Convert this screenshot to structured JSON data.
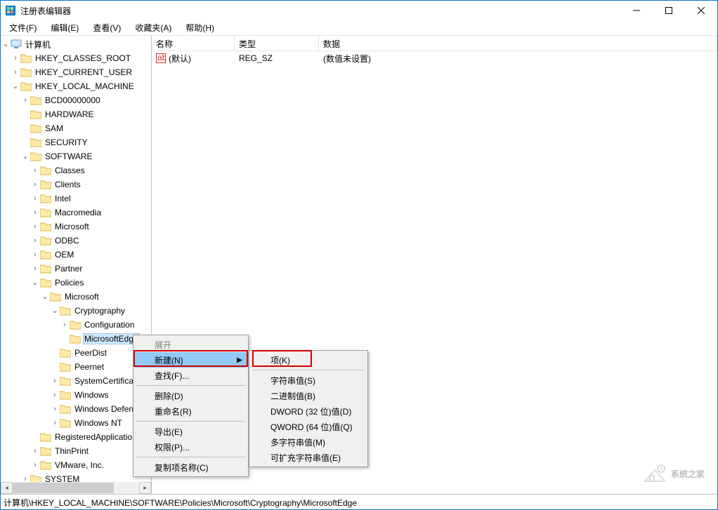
{
  "window": {
    "title": "注册表编辑器"
  },
  "menu": {
    "file": "文件(F)",
    "edit": "编辑(E)",
    "view": "查看(V)",
    "favorites": "收藏夹(A)",
    "help": "帮助(H)"
  },
  "tree": {
    "root": "计算机",
    "hkcr": "HKEY_CLASSES_ROOT",
    "hkcu": "HKEY_CURRENT_USER",
    "hklm": "HKEY_LOCAL_MACHINE",
    "bcd": "BCD00000000",
    "hardware": "HARDWARE",
    "sam": "SAM",
    "security": "SECURITY",
    "software": "SOFTWARE",
    "classes": "Classes",
    "clients": "Clients",
    "intel": "Intel",
    "macromedia": "Macromedia",
    "microsoft": "Microsoft",
    "odbc": "ODBC",
    "oem": "OEM",
    "partner": "Partner",
    "policies": "Policies",
    "policies_microsoft": "Microsoft",
    "cryptography": "Cryptography",
    "configuration": "Configuration",
    "microsoftedge": "MicrosoftEdge",
    "peerdist": "PeerDist",
    "peernet": "Peernet",
    "systemcert": "SystemCertificates",
    "windows": "Windows",
    "windowsdef": "Windows Defender",
    "windowsnt": "Windows NT",
    "regapps": "RegisteredApplications",
    "thinprint": "ThinPrint",
    "vmware": "VMware, Inc.",
    "system": "SYSTEM"
  },
  "list": {
    "headers": {
      "name": "名称",
      "type": "类型",
      "data": "数据"
    },
    "row0": {
      "name": "(默认)",
      "type": "REG_SZ",
      "data": "(数值未设置)"
    }
  },
  "ctx1": {
    "expand": "展开",
    "new": "新建(N)",
    "find": "查找(F)...",
    "delete": "删除(D)",
    "rename": "重命名(R)",
    "export": "导出(E)",
    "permissions": "权限(P)...",
    "copykey": "复制项名称(C)"
  },
  "ctx2": {
    "key": "项(K)",
    "string": "字符串值(S)",
    "binary": "二进制值(B)",
    "dword": "DWORD (32 位)值(D)",
    "qword": "QWORD (64 位)值(Q)",
    "multistring": "多字符串值(M)",
    "expandstring": "可扩充字符串值(E)"
  },
  "statusbar": "计算机\\HKEY_LOCAL_MACHINE\\SOFTWARE\\Policies\\Microsoft\\Cryptography\\MicrosoftEdge",
  "watermark": "系统之家"
}
